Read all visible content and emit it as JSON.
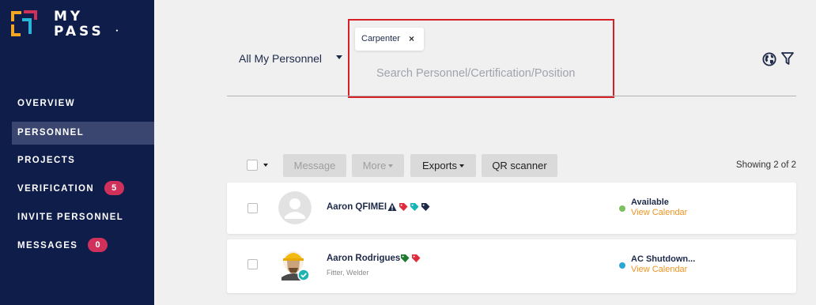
{
  "brand": {
    "line1": "MY",
    "line2": "PASS",
    "mark": "•"
  },
  "sidebar": {
    "items": [
      {
        "label": "OVERVIEW"
      },
      {
        "label": "PERSONNEL"
      },
      {
        "label": "PROJECTS"
      },
      {
        "label": "VERIFICATION",
        "badge": "5"
      },
      {
        "label": "INVITE PERSONNEL"
      },
      {
        "label": "MESSAGES",
        "badge": "0"
      }
    ]
  },
  "filter": {
    "scope_label": "All My Personnel"
  },
  "search": {
    "chip_label": "Carpenter",
    "chip_close": "×",
    "placeholder": "Search Personnel/Certification/Position",
    "value": ""
  },
  "header_icons": [
    "globe-icon",
    "filter-icon"
  ],
  "toolbar": {
    "message_label": "Message",
    "more_label": "More",
    "exports_label": "Exports",
    "qr_label": "QR scanner",
    "showing_text": "Showing 2 of 2"
  },
  "personnel": [
    {
      "name": "Aaron QFIMEI",
      "subtitle": "",
      "status": "Available",
      "calendar_label": "View Calendar",
      "status_color": "#7cc060",
      "tags": [
        "warning-icon",
        "red-tag-icon",
        "teal-tag-icon",
        "navy-tag-icon"
      ]
    },
    {
      "name": "Aaron Rodrigues",
      "subtitle": "Fitter, Welder",
      "status": "AC Shutdown...",
      "calendar_label": "View Calendar",
      "status_color": "#2aa7d5",
      "tags": [
        "green-tag-icon",
        "red-tag-icon"
      ]
    }
  ],
  "colors": {
    "sidebar_bg": "#0f1d4a",
    "badge": "#d0315a",
    "accent_orange": "#f0931e",
    "highlight_red": "#d61f26"
  }
}
